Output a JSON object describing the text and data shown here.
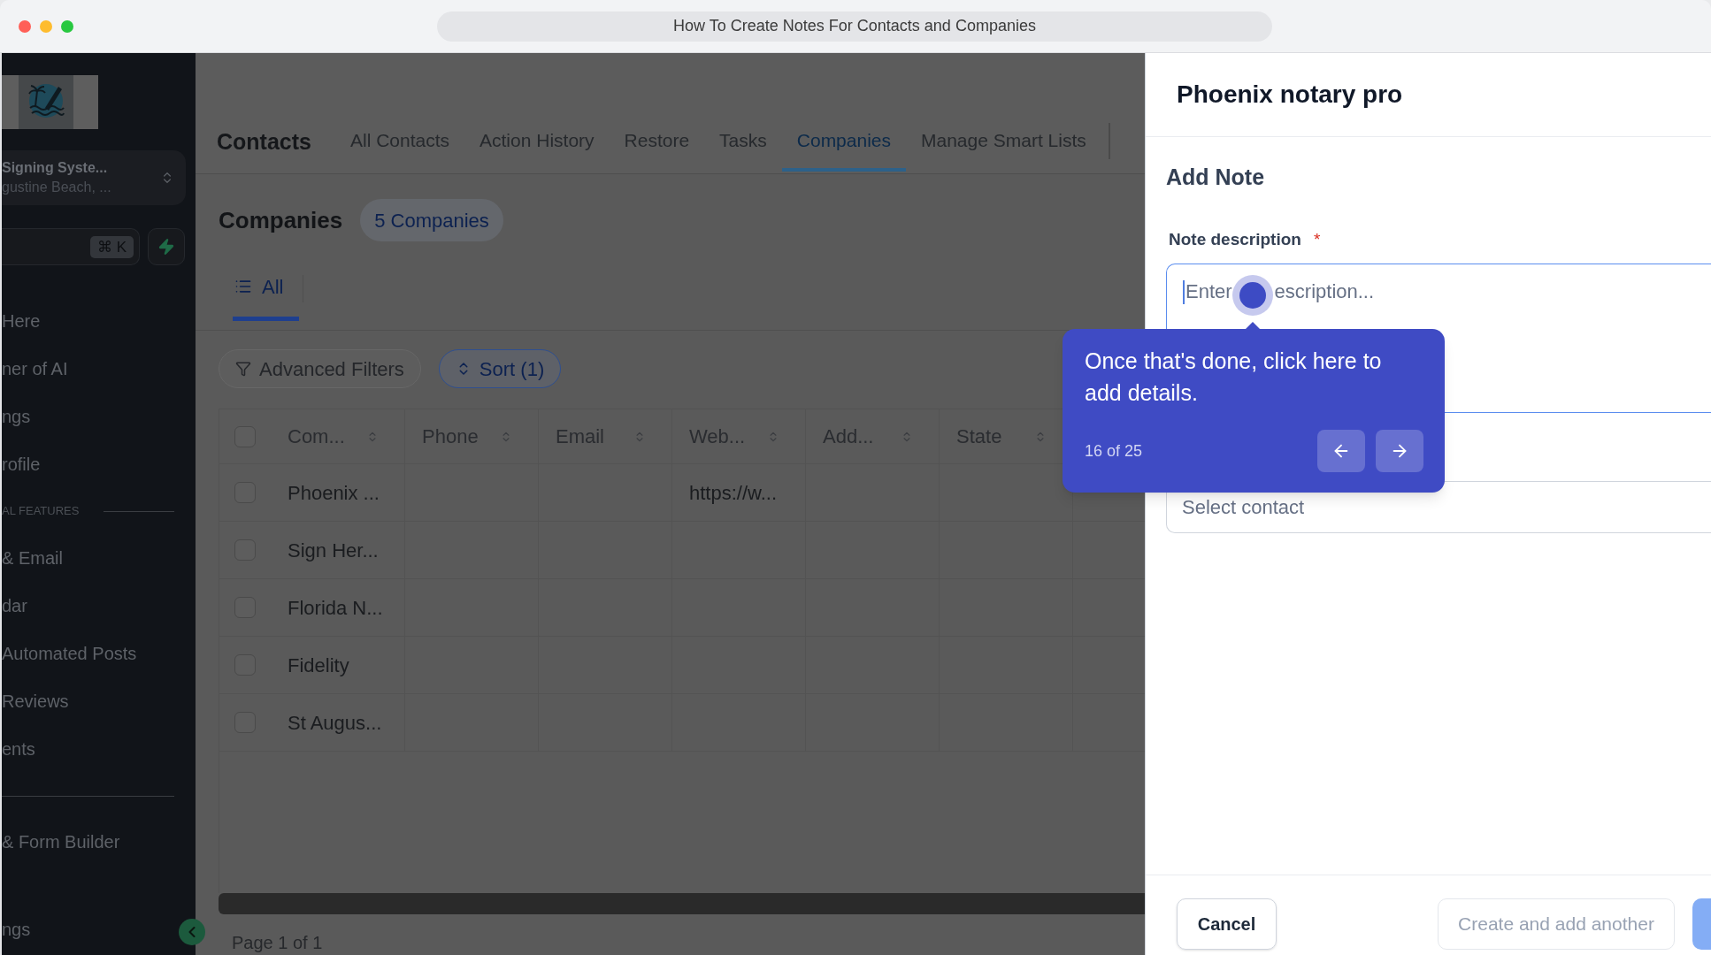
{
  "window": {
    "title": "How To Create Notes For Contacts and Companies"
  },
  "sidebar": {
    "account": {
      "name": "Signing Syste...",
      "location": "gustine Beach, ..."
    },
    "search": {
      "shortcut": "⌘ K"
    },
    "menu": [
      "Here",
      "ner of AI",
      "ngs",
      "rofile"
    ],
    "section": {
      "label": "AL FEATURES",
      "items": [
        "& Email",
        "dar",
        "Automated Posts",
        "Reviews",
        "ents"
      ]
    },
    "builders": [
      "& Form Builder"
    ],
    "bottom_item": "ngs"
  },
  "header": {
    "title": "Contacts",
    "tabs": [
      {
        "label": "All Contacts",
        "selected": false
      },
      {
        "label": "Action History",
        "selected": false
      },
      {
        "label": "Restore",
        "selected": false
      },
      {
        "label": "Tasks",
        "selected": false
      },
      {
        "label": "Companies",
        "selected": true
      },
      {
        "label": "Manage Smart Lists",
        "selected": false
      }
    ]
  },
  "companies": {
    "title": "Companies",
    "count": "5 Companies",
    "views": [
      {
        "label": "All",
        "selected": true
      }
    ],
    "toolbar": [
      {
        "kind": "filter",
        "label": "Advanced Filters",
        "active": false
      },
      {
        "kind": "sort",
        "label": "Sort (1)",
        "active": true
      }
    ]
  },
  "table": {
    "select_all": {
      "checked": false
    },
    "columns": [
      "Com...",
      "Phone",
      "Email",
      "Web...",
      "Add...",
      "State"
    ],
    "rows": [
      {
        "checked": false,
        "name": "Phoenix ...",
        "website": "https://w..."
      },
      {
        "checked": false,
        "name": "Sign Her..."
      },
      {
        "checked": false,
        "name": "Florida N..."
      },
      {
        "checked": false,
        "name": "Fidelity"
      },
      {
        "checked": false,
        "name": "St Augus..."
      }
    ],
    "pagination": "Page 1 of 1"
  },
  "panel": {
    "title": "Phoenix notary pro",
    "form_title": "Add Note",
    "description": {
      "label": "Note description",
      "required_mark": "*",
      "placeholder": [
        "Enter",
        "escription..."
      ],
      "focused": true
    },
    "contact": {
      "placeholder": "Select contact"
    },
    "buttons": [
      {
        "kind": "secondary",
        "label": "Cancel",
        "disabled": false
      },
      {
        "kind": "outline",
        "label": "Create and add another",
        "disabled": true
      },
      {
        "kind": "primary",
        "disabled": true
      }
    ]
  },
  "guide": {
    "text": "Once that's done, click here to add details.",
    "step": "16 of 25"
  }
}
